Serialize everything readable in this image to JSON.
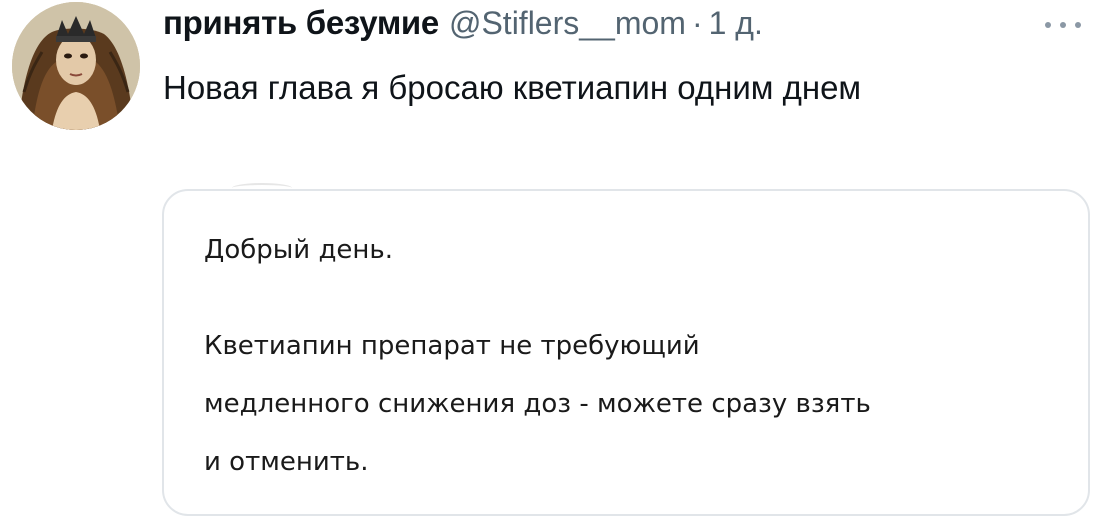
{
  "tweet": {
    "display_name": "принять безумие",
    "handle": "@Stiflers__mom",
    "separator": "·",
    "time": "1 д.",
    "text": "Новая глава я бросаю кветиапин одним днем",
    "more_icon": "more-horizontal-icon"
  },
  "quote": {
    "greeting": "Добрый день.",
    "body_lines": [
      "Кветиапин препарат не требующий",
      "медленного снижения доз - можете сразу взять",
      "и отменить."
    ]
  },
  "colors": {
    "text": "#0f1419",
    "secondary": "#536471",
    "border": "#e1e5e9",
    "background": "#ffffff"
  }
}
